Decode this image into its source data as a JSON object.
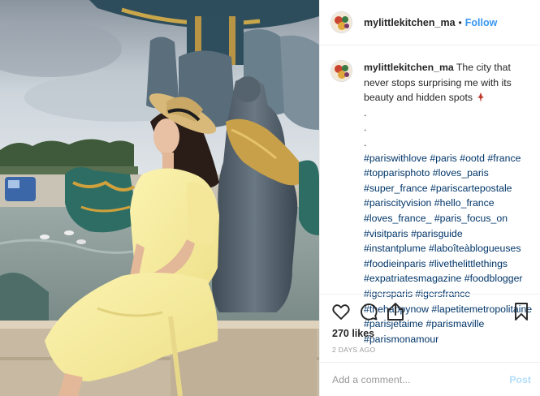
{
  "post": {
    "username": "mylittlekitchen_ma",
    "separator": "•",
    "follow_label": "Follow"
  },
  "caption": {
    "username": "mylittlekitchen_ma",
    "text": "The city that never stops surprising me with its beauty and hidden spots",
    "dots": [
      ".",
      ".",
      "."
    ],
    "hashtag_lines": [
      "#pariswithlove #paris #ootd #france",
      "#topparisphoto #loves_paris",
      "#super_france #pariscartepostale",
      "#pariscityvision #hello_france",
      "#loves_france_ #paris_focus_on",
      "#visitparis #parisguide",
      "#instantplume #laboîteàblogueuses",
      "#foodieinparis #livethelittlethings",
      "#expatriatesmagazine #foodblogger",
      "#igersparis #igersfrance",
      "#thehappynow #lapetitemetropolitaine",
      "#parisjetaime #parismaville",
      "#parismonamour"
    ]
  },
  "stats": {
    "likes": "270 likes",
    "date": "2 DAYS AGO"
  },
  "comment": {
    "placeholder": "Add a comment...",
    "post_label": "Post"
  },
  "icons": {
    "like": "heart-icon",
    "comment": "comment-bubble-icon",
    "share": "share-icon",
    "save": "bookmark-icon",
    "emoji": "pin-emoji"
  },
  "colors": {
    "link": "#3897f0",
    "hashtag": "#003569",
    "muted": "#999999",
    "post_disabled": "#b2dffc",
    "divider": "#efefef"
  }
}
